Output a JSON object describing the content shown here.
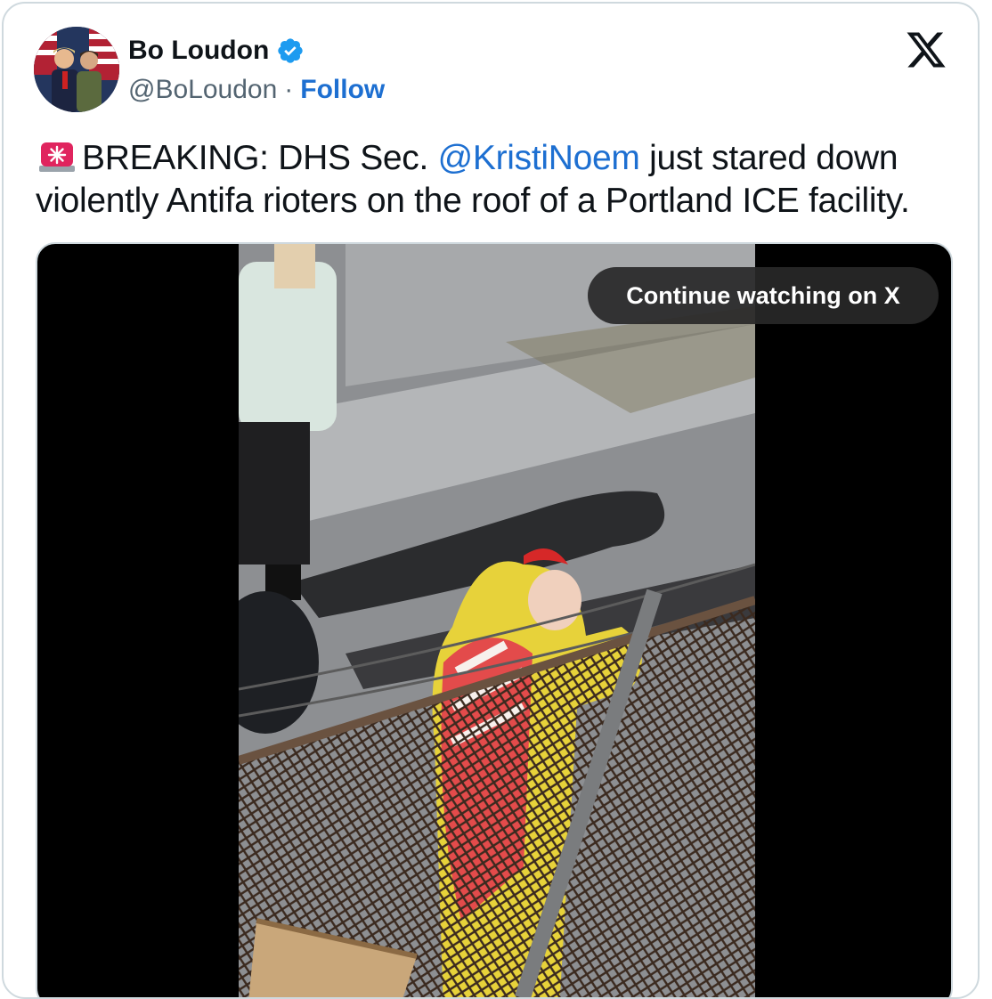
{
  "author": {
    "name": "Bo Loudon",
    "handle": "@BoLoudon",
    "separator": "·",
    "follow_label": "Follow",
    "verified_icon": "verified-badge-icon",
    "verified_color": "#1d9bf0"
  },
  "platform_icon": "x-logo-icon",
  "tweet": {
    "emoji": "siren-emoji",
    "text_before": "BREAKING: DHS Sec. ",
    "mention": "@KristiNoem",
    "text_after": " just stared down violently Antifa rioters on the roof of a Portland ICE facility."
  },
  "media": {
    "type": "video",
    "overlay_label": "Continue watching on X"
  },
  "colors": {
    "link": "#1d6fd1",
    "text": "#0f1419",
    "muted": "#536471",
    "border": "#cfd9de"
  }
}
